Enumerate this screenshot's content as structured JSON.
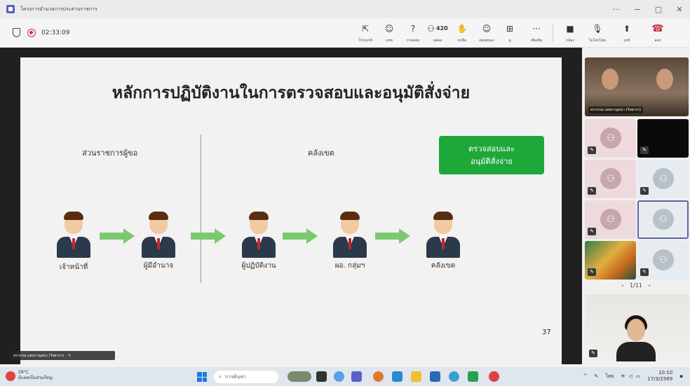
{
  "window": {
    "title": "โครงการอำนวยการประสานราชการ",
    "controls": [
      "···",
      "−",
      "▢",
      "✕"
    ]
  },
  "toolbar": {
    "timer": "02:33:09",
    "buttons": [
      {
        "icon": "share-tray-icon",
        "glyph": "⇱",
        "label": "โปรเจกท์"
      },
      {
        "icon": "chat-icon",
        "glyph": "☺",
        "label": "แชท"
      },
      {
        "icon": "qa-icon",
        "glyph": "?",
        "label": "ถามตอบ"
      },
      {
        "icon": "people-icon",
        "glyph": "⚇",
        "label": "บุคคล",
        "count": "420"
      },
      {
        "icon": "raise-hand-icon",
        "glyph": "✋",
        "label": "ยกมือ"
      },
      {
        "icon": "reactions-icon",
        "glyph": "☺",
        "label": "ตอบสนอง"
      },
      {
        "icon": "view-icon",
        "glyph": "⊞",
        "label": "ดู"
      },
      {
        "icon": "more-icon",
        "glyph": "···",
        "label": "เพิ่มเติม"
      },
      {
        "icon": "camera-icon",
        "glyph": "■",
        "label": "กล้อง"
      },
      {
        "icon": "mic-off-icon",
        "glyph": "🎙",
        "label": "ไมโครโฟน"
      },
      {
        "icon": "share-icon",
        "glyph": "⬆",
        "label": "แชร์"
      },
      {
        "icon": "leave-icon",
        "glyph": "☎",
        "label": "ออก"
      }
    ]
  },
  "slide": {
    "title": "หลักการปฏิบัติงานในการตรวจสอบและอนุมัติสั่งจ่าย",
    "section_left": "ส่วนราชการผู้ขอ",
    "section_right": "คลังเขต",
    "box_line1": "ตรวจสอบและ",
    "box_line2": "อนุมัติสั่งจ่าย",
    "people": [
      "เจ้าหน้าที่",
      "ผู้มีอำนาจ",
      "ผู้ปฏิบัติงาน",
      "ผอ. กลุ่มฯ",
      "คลังเขต"
    ],
    "page_number": "37"
  },
  "presenter_name": "อรวรรณ แสนกาญจนา (วิทยากร)",
  "panel": {
    "top_video_name": "อรวรรณ แสนกาญจนา (วิทยากร)",
    "pager": "1/11"
  },
  "taskbar": {
    "weather_temp": "28°C",
    "weather_desc": "มีแดดเป็นส่วนใหญ่",
    "search_placeholder": "การค้นหา",
    "lang": "ไทย",
    "time": "10:10",
    "date": "17/3/2569"
  },
  "colors": {
    "slide_box": "#1ea83a",
    "arrow": "#7bc96f",
    "accent": "#6264a7",
    "record": "#c4314b"
  }
}
